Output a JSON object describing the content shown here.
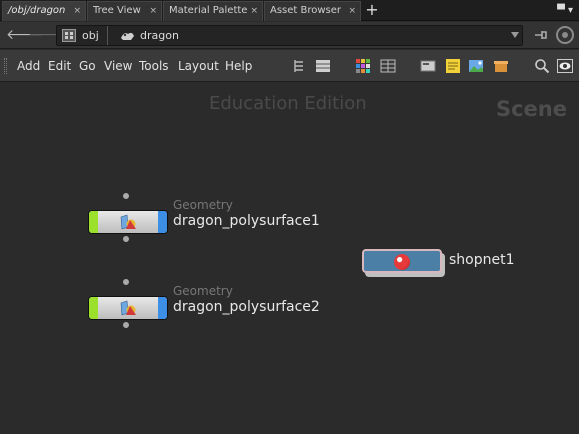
{
  "tabs": [
    {
      "label": "/obj/dragon",
      "active": true,
      "close": "×"
    },
    {
      "label": "Tree View",
      "active": false,
      "close": "×"
    },
    {
      "label": "Material Palette",
      "active": false,
      "close": "×"
    },
    {
      "label": "Asset Browser",
      "active": false,
      "close": "×"
    }
  ],
  "add_tab_icon": "+",
  "tab_menu_icon": "▀ ▾",
  "path": {
    "back_icon": "🡐",
    "forward_icon": "🡒",
    "crumbs": [
      {
        "label": "obj",
        "icon": "obj-network-icon"
      },
      {
        "label": "dragon",
        "icon": "geometry-object-icon"
      }
    ]
  },
  "menu": {
    "items": [
      "Add",
      "Edit",
      "Go",
      "View",
      "Tools",
      "Layout",
      "Help"
    ]
  },
  "canvas": {
    "watermark": "Education Edition",
    "context_label": "Scene",
    "nodes": [
      {
        "type": "Geometry",
        "name": "dragon_polysurface1"
      },
      {
        "type": "Geometry",
        "name": "dragon_polysurface2"
      },
      {
        "type": "",
        "name": "shopnet1"
      }
    ]
  },
  "colors": {
    "display_flag": "#9be02b",
    "render_flag": "#3c8fe5",
    "shopnet_body": "#4c7fa6"
  }
}
